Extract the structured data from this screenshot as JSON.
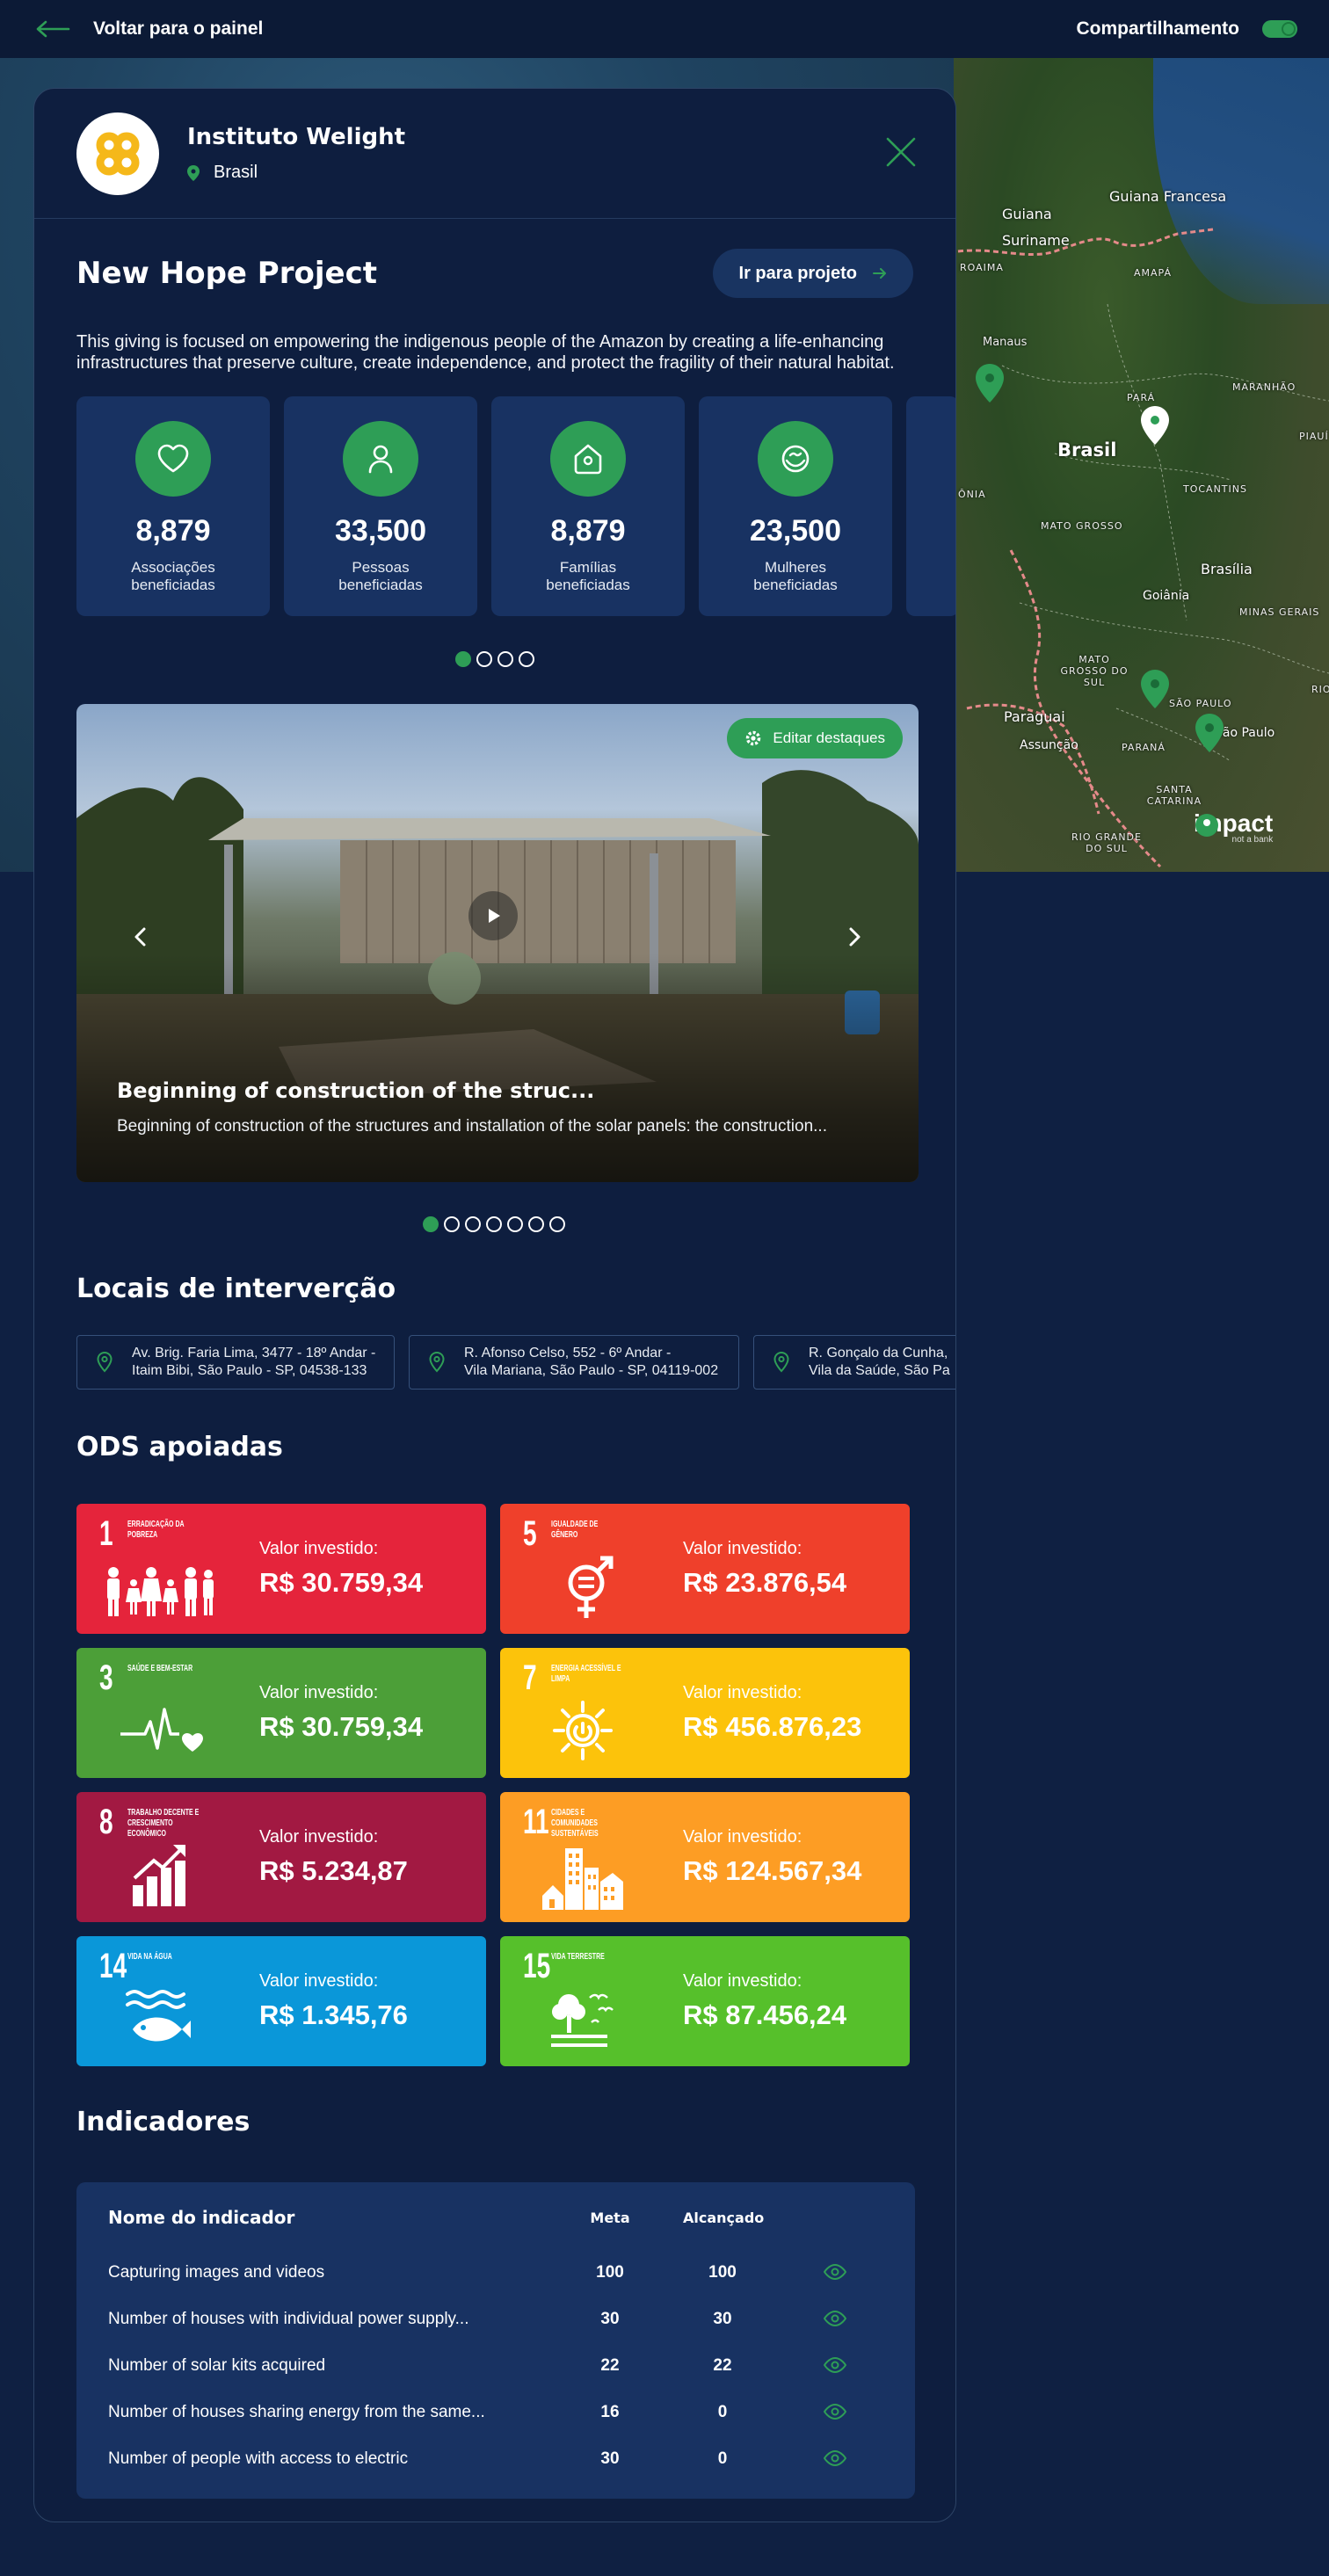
{
  "topbar": {
    "back_label": "Voltar para o painel",
    "share_label": "Compartilhamento"
  },
  "map": {
    "labels": [
      "Guiana",
      "Guiana Francesa",
      "Suriname",
      "AMAPÁ",
      "ROAIMA",
      "Manaus",
      "PARÁ",
      "MARANHÃO",
      "PIAUÍ",
      "Brasil",
      "ÔNIA",
      "TOCANTINS",
      "MATO GROSSO",
      "Brasília",
      "Goiânia",
      "MINAS GERAIS",
      "MATO GROSSO DO SUL",
      "Paraguai",
      "Assunção",
      "PARANÁ",
      "SÃO PAULO",
      "São Paulo",
      "SANTA CATARINA",
      "RIO GRANDE DO SUL",
      "RIO"
    ],
    "brand": "impact",
    "brand_tag": "not a bank"
  },
  "org": {
    "name": "Instituto Welight",
    "country": "Brasil"
  },
  "project": {
    "title": "New Hope Project",
    "button": "Ir para projeto",
    "description": "This giving is focused on empowering the indigenous people of the Amazon by creating a life-enhancing infrastructures that preserve culture, create independence, and protect the fragility of their natural habitat."
  },
  "stats": [
    {
      "icon": "heart-icon",
      "value": "8,879",
      "label1": "Associações",
      "label2": "beneficiadas"
    },
    {
      "icon": "person-icon",
      "value": "33,500",
      "label1": "Pessoas",
      "label2": "beneficiadas"
    },
    {
      "icon": "house-icon",
      "value": "8,879",
      "label1": "Famílias",
      "label2": "beneficiadas"
    },
    {
      "icon": "handshake-icon",
      "value": "23,500",
      "label1": "Mulheres",
      "label2": "beneficiadas"
    }
  ],
  "stats_pager": {
    "pages": 4,
    "current": 1
  },
  "highlight": {
    "edit_button": "Editar destaques",
    "title": "Beginning of construction of the struc...",
    "text": "Beginning of construction of the structures and installation of the solar panels: the construction...",
    "pages": 7,
    "current": 1
  },
  "locations": {
    "title": "Locais de interverção",
    "items": [
      {
        "line1": "Av. Brig. Faria Lima, 3477 - 18º Andar -",
        "line2": "Itaim Bibi, São Paulo - SP, 04538-133"
      },
      {
        "line1": "R. Afonso Celso, 552 - 6º Andar -",
        "line2": "Vila Mariana, São Paulo - SP, 04119-002"
      },
      {
        "line1": "R. Gonçalo da Cunha,",
        "line2": "Vila da Saúde, São Pa"
      }
    ]
  },
  "ods": {
    "title": "ODS apoiadas",
    "value_label": "Valor investido:",
    "items": [
      {
        "num": "1",
        "name": "ERRADICAÇÃO DA POBREZA",
        "value": "R$ 30.759,34",
        "color": "#e5243b",
        "icon": "poverty-family-icon"
      },
      {
        "num": "5",
        "name": "IGUALDADE DE GÊNERO",
        "value": "R$ 23.876,54",
        "color": "#ef402b",
        "icon": "gender-equality-icon"
      },
      {
        "num": "3",
        "name": "SAÚDE E BEM-ESTAR",
        "value": "R$ 30.759,34",
        "color": "#4c9f38",
        "icon": "heartbeat-icon"
      },
      {
        "num": "7",
        "name": "ENERGIA ACESSÍVEL E LIMPA",
        "value": "R$ 456.876,23",
        "color": "#fcc30b",
        "icon": "sun-power-icon"
      },
      {
        "num": "8",
        "name": "TRABALHO DECENTE E CRESCIMENTO ECONÔMICO",
        "value": "R$ 5.234,87",
        "color": "#a21942",
        "icon": "growth-chart-icon"
      },
      {
        "num": "11",
        "name": "CIDADES E COMUNIDADES SUSTENTÁVEIS",
        "value": "R$ 124.567,34",
        "color": "#fd9d24",
        "icon": "city-buildings-icon"
      },
      {
        "num": "14",
        "name": "VIDA NA ÁGUA",
        "value": "R$ 1.345,76",
        "color": "#0a97d9",
        "icon": "fish-water-icon"
      },
      {
        "num": "15",
        "name": "VIDA TERRESTRE",
        "value": "R$ 87.456,24",
        "color": "#56c02b",
        "icon": "tree-bird-icon"
      }
    ]
  },
  "indicators": {
    "title": "Indicadores",
    "col_name": "Nome do indicador",
    "col_goal": "Meta",
    "col_done": "Alcançado",
    "rows": [
      {
        "name": "Capturing images and videos",
        "goal": "100",
        "done": "100"
      },
      {
        "name": "Number of houses with individual power supply...",
        "goal": "30",
        "done": "30"
      },
      {
        "name": "Number of solar kits acquired",
        "goal": "22",
        "done": "22"
      },
      {
        "name": "Number of houses sharing energy from the same...",
        "goal": "16",
        "done": "0"
      },
      {
        "name": "Number of people with access to electric",
        "goal": "30",
        "done": "0"
      }
    ]
  },
  "colors": {
    "accent": "#2e9e56",
    "panel": "#0e1e3f",
    "card": "#183262"
  }
}
